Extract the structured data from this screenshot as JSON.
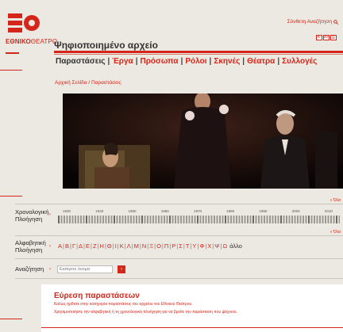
{
  "brand": {
    "logo_text_bold": "ΕΘΝΙΚΟ",
    "logo_text_rest": "ΘΕΑΤΡΟ",
    "logo_icon": "national-theatre-logo",
    "site_title": "Ψηφιοποιημένο αρχείο"
  },
  "header": {
    "advanced_search_label": "Σύνθετη Αναζήτηση",
    "font_buttons": [
      "A-",
      "A+",
      "⎙"
    ]
  },
  "nav": {
    "items": [
      {
        "label": "Παραστάσεις",
        "active": true
      },
      {
        "label": "Έργα",
        "active": false
      },
      {
        "label": "Πρόσωπα",
        "active": false
      },
      {
        "label": "Ρόλοι",
        "active": false
      },
      {
        "label": "Σκηνές",
        "active": false
      },
      {
        "label": "Θέατρα",
        "active": false
      },
      {
        "label": "Συλλογές",
        "active": false
      }
    ],
    "separator": "|"
  },
  "breadcrumb": "Αρχική Σελίδα / Παραστάσεις",
  "chronological": {
    "label_line1": "Χρονολογική",
    "label_line2": "Πλοήγηση",
    "all_link": "» Όλα",
    "years": [
      "1930",
      "1940",
      "1950",
      "1960",
      "1970",
      "1980",
      "1990",
      "2000",
      "2010"
    ]
  },
  "alphabetical": {
    "label_line1": "Αλφαβητική",
    "label_line2": "Πλοήγηση",
    "all_link": "» Όλα",
    "letters": [
      "Α",
      "Β",
      "Γ",
      "Δ",
      "Ε",
      "Ζ",
      "Η",
      "Θ",
      "Ι",
      "Κ",
      "Λ",
      "Μ",
      "Ν",
      "Ξ",
      "Ο",
      "Π",
      "Ρ",
      "Σ",
      "Τ",
      "Υ",
      "Φ",
      "Χ",
      "Ψ",
      "Ω"
    ],
    "other_label": "άλλο"
  },
  "search": {
    "label": "Αναζήτηση",
    "placeholder": "Εισάγετε όνομα",
    "go_label": "›"
  },
  "find": {
    "heading": "Εύρεση παραστάσεων",
    "line1": "Καλώς ήρθατε στην κατηγορία παραστάσεις του αρχείου του Εθνικού Θεάτρου.",
    "line2": "Χρησιμοποιήστε την αλφαβητική ή τη χρονολογική πλοήγηση για να βρείτε την παράσταση που ψάχνετε."
  },
  "colors": {
    "accent": "#d4261a",
    "background": "#ece9e2"
  }
}
